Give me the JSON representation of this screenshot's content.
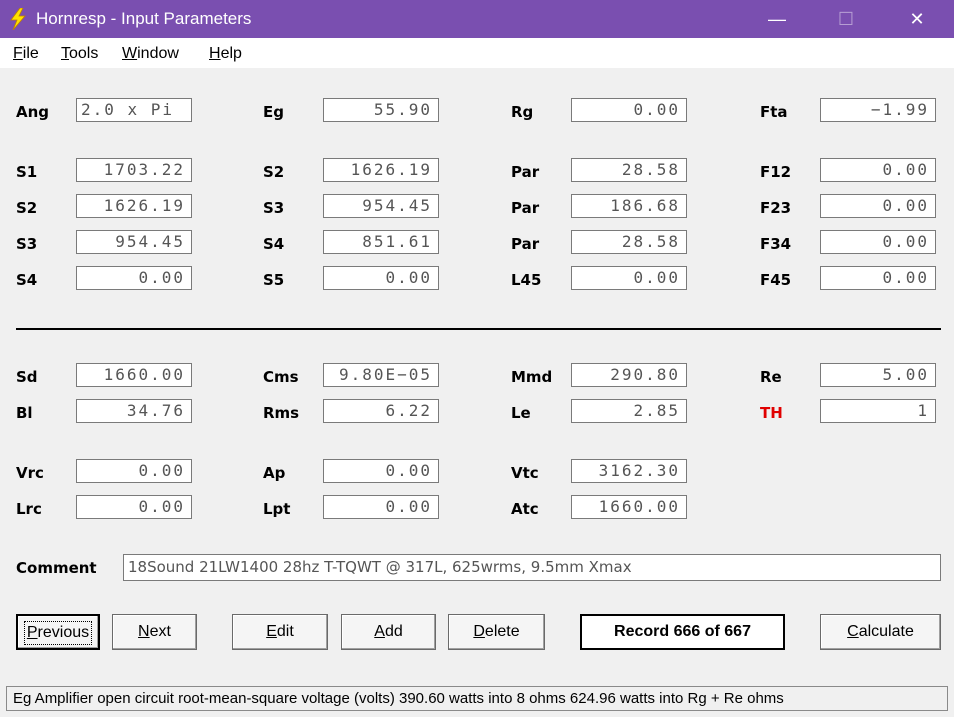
{
  "window": {
    "title": "Hornresp - Input Parameters",
    "accent_color": "#7a4fb0",
    "icon": "lightning-bolt-icon",
    "controls": {
      "minimize": "—",
      "maximize": "☐",
      "close": "✕"
    }
  },
  "menu": [
    {
      "u": "F",
      "rest": "ile"
    },
    {
      "u": "T",
      "rest": "ools"
    },
    {
      "u": "W",
      "rest": "indow"
    },
    {
      "u": "H",
      "rest": "elp"
    }
  ],
  "params": {
    "ang": {
      "label": "Ang",
      "value": "2.0 x Pi"
    },
    "eg": {
      "label": "Eg",
      "value": "55.90"
    },
    "rg": {
      "label": "Rg",
      "value": "0.00"
    },
    "fta": {
      "label": "Fta",
      "value": "−1.99"
    },
    "s1": {
      "label": "S1",
      "value": "1703.22"
    },
    "s2_b": {
      "label": "S2",
      "value": "1626.19"
    },
    "par1": {
      "label": "Par",
      "value": "28.58"
    },
    "f12": {
      "label": "F12",
      "value": "0.00"
    },
    "s2": {
      "label": "S2",
      "value": "1626.19"
    },
    "s3_b": {
      "label": "S3",
      "value": "954.45"
    },
    "par2": {
      "label": "Par",
      "value": "186.68"
    },
    "f23": {
      "label": "F23",
      "value": "0.00"
    },
    "s3": {
      "label": "S3",
      "value": "954.45"
    },
    "s4_b": {
      "label": "S4",
      "value": "851.61"
    },
    "par3": {
      "label": "Par",
      "value": "28.58"
    },
    "f34": {
      "label": "F34",
      "value": "0.00"
    },
    "s4": {
      "label": "S4",
      "value": "0.00"
    },
    "s5": {
      "label": "S5",
      "value": "0.00"
    },
    "l45": {
      "label": "L45",
      "value": "0.00"
    },
    "f45": {
      "label": "F45",
      "value": "0.00"
    },
    "sd": {
      "label": "Sd",
      "value": "1660.00"
    },
    "cms": {
      "label": "Cms",
      "value": "9.80E−05"
    },
    "mmd": {
      "label": "Mmd",
      "value": "290.80"
    },
    "re": {
      "label": "Re",
      "value": "5.00"
    },
    "bl": {
      "label": "Bl",
      "value": "34.76"
    },
    "rms": {
      "label": "Rms",
      "value": "6.22"
    },
    "le": {
      "label": "Le",
      "value": "2.85"
    },
    "th": {
      "label": "TH",
      "value": "1",
      "label_color": "#e00000"
    },
    "vrc": {
      "label": "Vrc",
      "value": "0.00"
    },
    "ap": {
      "label": "Ap",
      "value": "0.00"
    },
    "vtc": {
      "label": "Vtc",
      "value": "3162.30"
    },
    "lrc": {
      "label": "Lrc",
      "value": "0.00"
    },
    "lpt": {
      "label": "Lpt",
      "value": "0.00"
    },
    "atc": {
      "label": "Atc",
      "value": "1660.00"
    }
  },
  "comment": {
    "label": "Comment",
    "value": "18Sound 21LW1400 28hz T-TQWT @ 317L, 625wrms, 9.5mm Xmax"
  },
  "buttons": {
    "previous": {
      "u": "P",
      "rest": "revious"
    },
    "next": {
      "u": "N",
      "rest": "ext"
    },
    "edit": {
      "u": "E",
      "rest": "dit"
    },
    "add": {
      "u": "A",
      "rest": "dd"
    },
    "delete": {
      "u": "D",
      "rest": "elete"
    },
    "calculate": {
      "u": "C",
      "rest": "alculate"
    }
  },
  "record": "Record 666 of 667",
  "status": "Eg   Amplifier open circuit root-mean-square voltage  (volts)   390.60 watts into 8 ohms    624.96 watts into Rg + Re ohms"
}
